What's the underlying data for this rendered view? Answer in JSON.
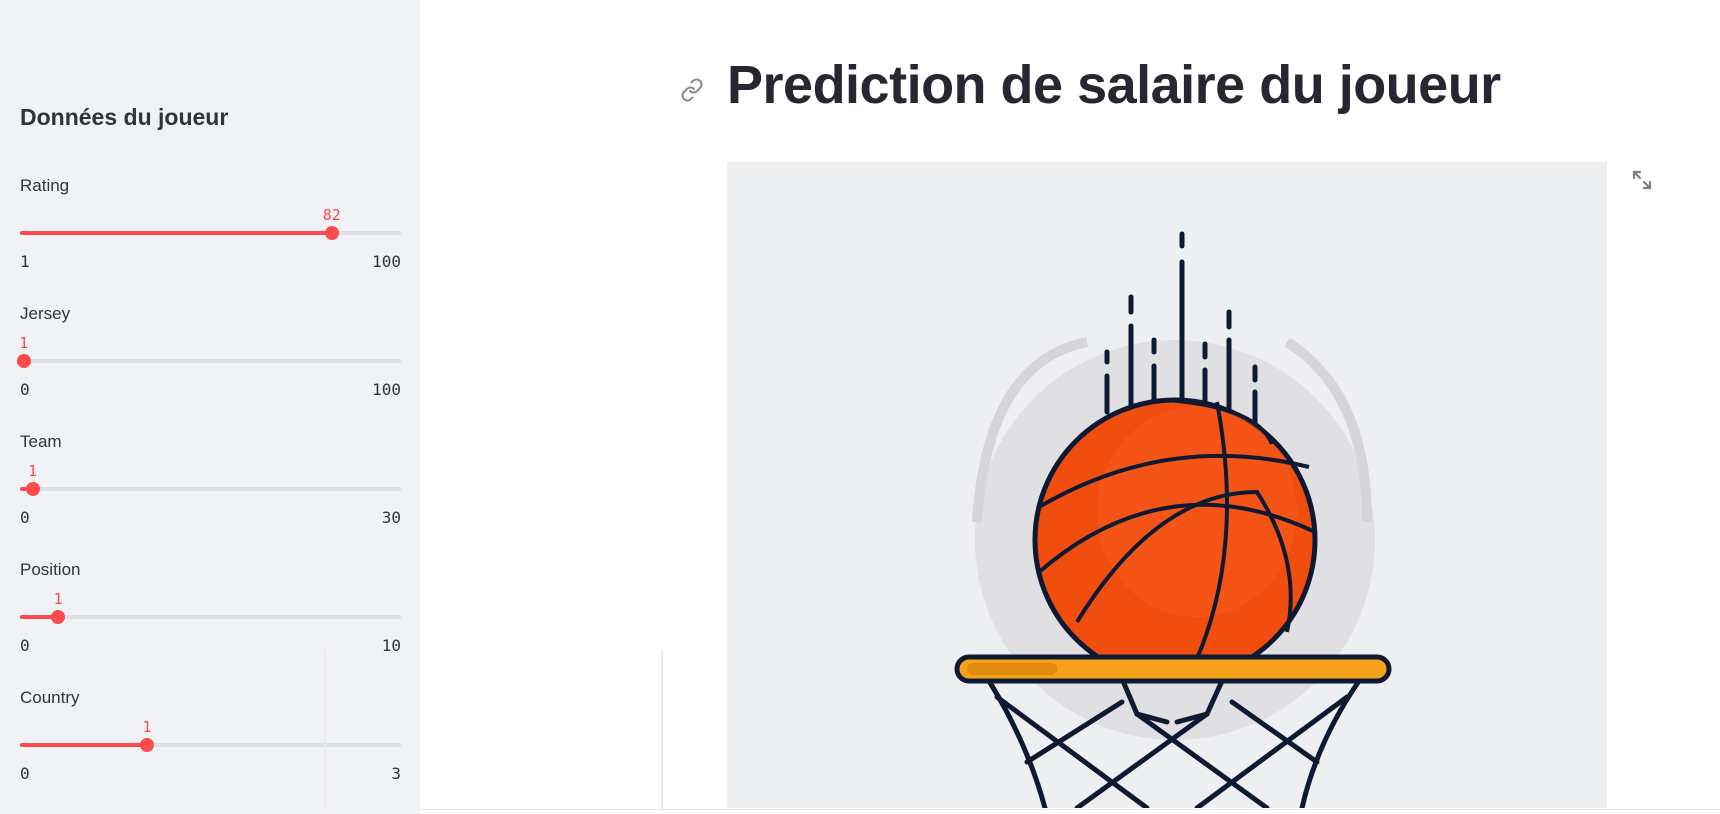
{
  "sidebar": {
    "title": "Données du joueur",
    "sliders": [
      {
        "label": "Rating",
        "value": 82,
        "min": 1,
        "max": 100
      },
      {
        "label": "Jersey",
        "value": 1,
        "min": 0,
        "max": 100
      },
      {
        "label": "Team",
        "value": 1,
        "min": 0,
        "max": 30
      },
      {
        "label": "Position",
        "value": 1,
        "min": 0,
        "max": 10
      },
      {
        "label": "Country",
        "value": 1,
        "min": 0,
        "max": 3
      }
    ]
  },
  "main": {
    "title": "Prediction de salaire du joueur",
    "image": {
      "icon": "basketball-hoop-illustration"
    }
  },
  "colors": {
    "accent": "#ff4b4b",
    "sidebar_bg": "#f0f2f6",
    "ball": "#f04d0f",
    "rim": "#f5a21a",
    "outline": "#0e1a33"
  }
}
